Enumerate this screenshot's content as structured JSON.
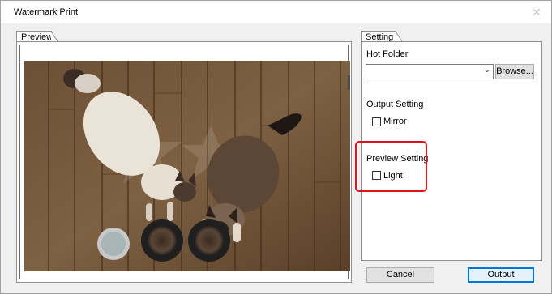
{
  "window": {
    "title": "Watermark Print"
  },
  "preview": {
    "tab_label": "Preview"
  },
  "setting": {
    "tab_label": "Setting",
    "hot_folder_label": "Hot Folder",
    "hot_folder_value": "",
    "browse_label": "Browse...",
    "output_setting_label": "Output Setting",
    "mirror_label": "Mirror",
    "mirror_checked": false,
    "preview_setting_label": "Preview Setting",
    "light_label": "Light",
    "light_checked": false
  },
  "footer": {
    "cancel_label": "Cancel",
    "output_label": "Output"
  },
  "colors": {
    "highlight": "#e0141e",
    "default_button_border": "#0078d7"
  },
  "icons": {
    "close": "close-icon",
    "dropdown": "chevron-down-icon"
  }
}
